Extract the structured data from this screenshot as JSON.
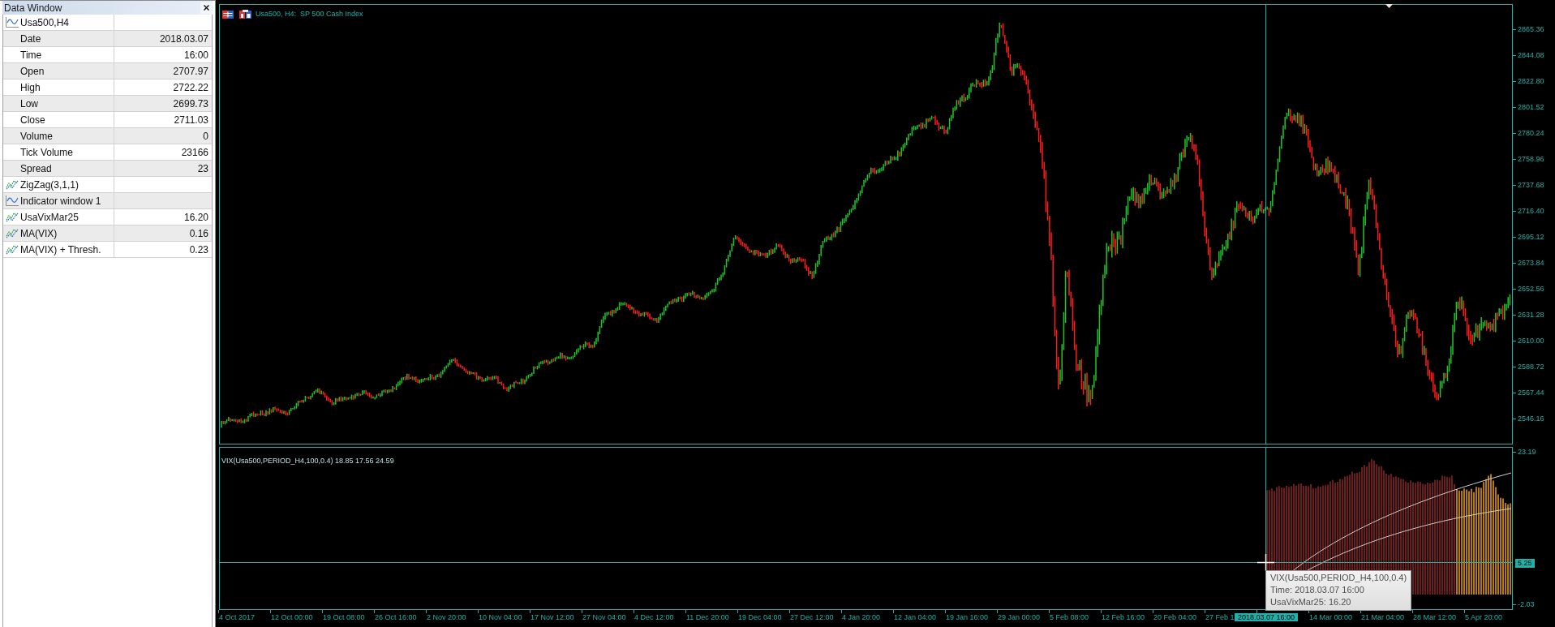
{
  "data_window": {
    "title": "Data Window",
    "rows": [
      {
        "kind": "chart",
        "label": "Usa500,H4"
      },
      {
        "kind": "field",
        "label": "Date",
        "value": "2018.03.07"
      },
      {
        "kind": "field",
        "label": "Time",
        "value": "16:00"
      },
      {
        "kind": "field",
        "label": "Open",
        "value": "2707.97"
      },
      {
        "kind": "field",
        "label": "High",
        "value": "2722.22"
      },
      {
        "kind": "field",
        "label": "Low",
        "value": "2699.73"
      },
      {
        "kind": "field",
        "label": "Close",
        "value": "2711.03"
      },
      {
        "kind": "field",
        "label": "Volume",
        "value": "0"
      },
      {
        "kind": "field",
        "label": "Tick Volume",
        "value": "23166"
      },
      {
        "kind": "field",
        "label": "Spread",
        "value": "23"
      },
      {
        "kind": "indicator",
        "label": "ZigZag(3,1,1)"
      },
      {
        "kind": "chart",
        "label": "Indicator window 1"
      },
      {
        "kind": "indicator",
        "label": "UsaVixMar25",
        "value": "16.20"
      },
      {
        "kind": "indicator",
        "label": "MA(VIX)",
        "value": "0.16"
      },
      {
        "kind": "indicator",
        "label": "MA(VIX) + Thresh.",
        "value": "0.23"
      }
    ]
  },
  "chart": {
    "title": "Usa500, H4:  SP 500 Cash Index",
    "price_axis": [
      "2865.36",
      "2844.08",
      "2822.80",
      "2801.52",
      "2780.24",
      "2758.96",
      "2737.68",
      "2716.40",
      "2695.12",
      "2673.84",
      "2652.56",
      "2631.28",
      "2610.00",
      "2588.72",
      "2567.44",
      "2546.16"
    ]
  },
  "indicator": {
    "title": "VIX(Usa500,PERIOD_H4,100,0.4) 18.85 17.56 24.59",
    "axis": [
      "23.19",
      "-2.03"
    ],
    "crosshair_value": "5.25",
    "tooltip": [
      "VIX(Usa500,PERIOD_H4,100,0.4)",
      "Time: 2018.03.07 16:00",
      "UsaVixMar25: 16.20"
    ]
  },
  "time_axis": {
    "labels": [
      "4 Oct 2017",
      "12 Oct 00:00",
      "19 Oct 08:00",
      "26 Oct 16:00",
      "2 Nov 20:00",
      "10 Nov 04:00",
      "17 Nov 12:00",
      "27 Nov 04:00",
      "4 Dec 12:00",
      "11 Dec 20:00",
      "19 Dec 04:00",
      "27 Dec 12:00",
      "4 Jan 20:00",
      "12 Jan 04:00",
      "19 Jan 16:00",
      "29 Jan 00:00",
      "5 Feb 08:00",
      "12 Feb 16:00",
      "20 Feb 04:00",
      "27 Feb 1",
      "14 Mar 00:00",
      "21 Mar 04:00",
      "28 Mar 12:00",
      "5 Apr 20:00"
    ],
    "crosshair_label": "2018.03.07 16:00"
  }
}
